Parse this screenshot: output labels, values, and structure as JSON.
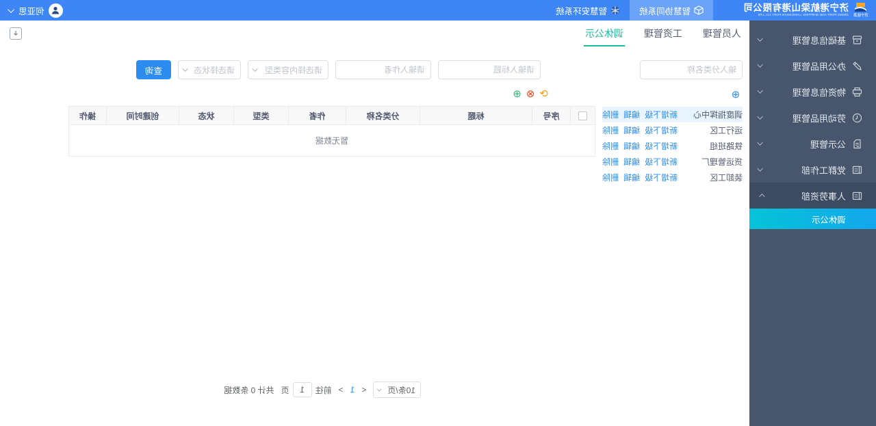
{
  "topbar": {
    "logo": {
      "company_small": "济宁能源",
      "title": "济宁港航梁山港有限公司",
      "subtitle": "JINING PORT AND SHIPPING LIANGSHAN PORT CO.,LTD"
    },
    "nav": [
      {
        "label": "智慧协同系统",
        "active": true
      },
      {
        "label": "智慧安环系统",
        "active": false
      }
    ],
    "user": {
      "name": "何亚思"
    }
  },
  "sidebar": {
    "items": [
      {
        "label": "基础信息管理"
      },
      {
        "label": "办公用品管理"
      },
      {
        "label": "物资信息管理"
      },
      {
        "label": "劳动用品管理"
      },
      {
        "label": "公示管理"
      },
      {
        "label": "党群工作部"
      },
      {
        "label": "人事劳资部",
        "expanded": true
      }
    ],
    "submenu": {
      "label": "调休公示",
      "active": true
    }
  },
  "tabs": [
    {
      "label": "人员管理",
      "active": false
    },
    {
      "label": "工资管理",
      "active": false
    },
    {
      "label": "调休公示",
      "active": true
    }
  ],
  "tree": {
    "search_placeholder": "输入分类名称",
    "add_icon": "⊕",
    "nodes": [
      {
        "name": "调度指挥中心",
        "selected": true
      },
      {
        "name": "运行工区",
        "selected": false
      },
      {
        "name": "铁路班组",
        "selected": false
      },
      {
        "name": "货运管理厂",
        "selected": false
      },
      {
        "name": "装卸工区",
        "selected": false
      }
    ],
    "actions": [
      "新增下级",
      "编辑",
      "删除"
    ]
  },
  "filters": {
    "title_placeholder": "请输入标题",
    "author_placeholder": "请输入作者",
    "type_placeholder": "请选择内容类型",
    "status_placeholder": "请选择状态",
    "search_label": "查询"
  },
  "toolbar": {
    "refresh_icon": "⟳",
    "delete_icon": "⊗",
    "add_icon": "⊕"
  },
  "table": {
    "headers": [
      "序号",
      "标题",
      "分类名称",
      "作者",
      "类型",
      "状态",
      "创建时间",
      "操作"
    ],
    "empty_text": "暂无数据"
  },
  "pagination": {
    "page_size": "10条/页",
    "prev": "<",
    "next": ">",
    "current_page": "1",
    "jump_prefix": "前往",
    "jump_suffix": "页",
    "jump_value": "1",
    "total_text": "共计 0 条数据"
  },
  "colors": {
    "topbar": "#3e86f6",
    "topnav_active": "#6ba3f8",
    "sidebar": "#47566c",
    "sidebar_open": "#3c4b61",
    "submenu_gradient_start": "#13a7ec",
    "submenu_gradient_end": "#06c3d7",
    "tab_active": "#1abc9c",
    "link_blue": "#2d8cf0",
    "toolbar_orange": "#ff9900",
    "toolbar_red": "#ed4014",
    "toolbar_green": "#19be6b"
  }
}
